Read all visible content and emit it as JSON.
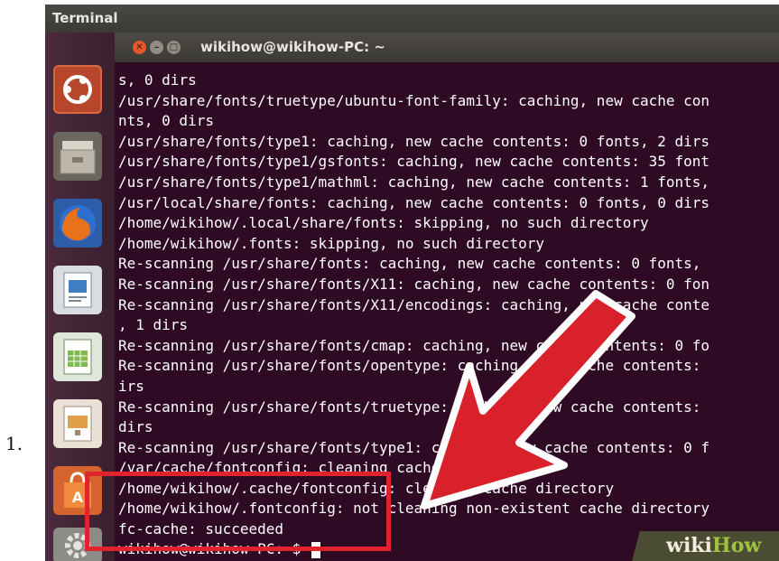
{
  "list_marker": "1.",
  "topbar": {
    "app_name": "Terminal"
  },
  "window": {
    "title": "wikihow@wikihow-PC: ~"
  },
  "launcher": {
    "items": [
      {
        "name": "ubuntu-dash",
        "icon": "ubuntu-logo-icon"
      },
      {
        "name": "files",
        "icon": "file-cabinet-icon"
      },
      {
        "name": "firefox",
        "icon": "firefox-icon"
      },
      {
        "name": "writer",
        "icon": "writer-document-icon"
      },
      {
        "name": "calc",
        "icon": "calc-spreadsheet-icon"
      },
      {
        "name": "impress",
        "icon": "impress-presentation-icon"
      },
      {
        "name": "software-center",
        "icon": "shopping-bag-icon"
      },
      {
        "name": "system-settings",
        "icon": "gear-icon"
      }
    ]
  },
  "terminal": {
    "lines": [
      "s, 0 dirs",
      "/usr/share/fonts/truetype/ubuntu-font-family: caching, new cache con",
      "nts, 0 dirs",
      "/usr/share/fonts/type1: caching, new cache contents: 0 fonts, 2 dirs",
      "/usr/share/fonts/type1/gsfonts: caching, new cache contents: 35 font",
      "/usr/share/fonts/type1/mathml: caching, new cache contents: 1 fonts,",
      "/usr/local/share/fonts: caching, new cache contents: 0 fonts, 0 dirs",
      "/home/wikihow/.local/share/fonts: skipping, no such directory",
      "/home/wikihow/.fonts: skipping, no such directory",
      "Re-scanning /usr/share/fonts: caching, new cache contents: 0 fonts,",
      "Re-scanning /usr/share/fonts/X11: caching, new cache contents: 0 fon",
      "Re-scanning /usr/share/fonts/X11/encodings: caching, new cache conte",
      ", 1 dirs",
      "Re-scanning /usr/share/fonts/cmap: caching, new cache contents: 0 fo",
      "Re-scanning /usr/share/fonts/opentype: caching, new cache contents:",
      "irs",
      "Re-scanning /usr/share/fonts/truetype: caching, new cache contents:",
      "dirs",
      "Re-scanning /usr/share/fonts/type1: caching, new cache contents: 0 f",
      "/var/cache/fontconfig: cleaning cache directory",
      "/home/wikihow/.cache/fontconfig: cleaning cache directory",
      "/home/wikihow/.fontconfig: not cleaning non-existent cache directory",
      "fc-cache: succeeded"
    ],
    "prompt": "wikihow@wikihow-PC:~$ "
  },
  "annotation": {
    "highlight_color": "#e0232c"
  },
  "watermark": {
    "prefix": "wiki",
    "suffix": "How"
  }
}
